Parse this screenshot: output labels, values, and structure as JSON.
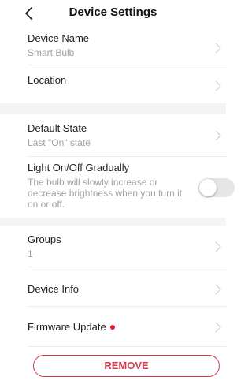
{
  "header": {
    "title": "Device Settings",
    "back_icon": "chevron-left-icon"
  },
  "device_name": {
    "label": "Device Name",
    "value": "Smart Bulb"
  },
  "location": {
    "label": "Location"
  },
  "default_state": {
    "label": "Default State",
    "value": "Last \"On\" state"
  },
  "gradual": {
    "label": "Light On/Off Gradually",
    "description": "The bulb will slowly increase or decrease brightness when you turn it on or off.",
    "enabled": false
  },
  "groups": {
    "label": "Groups",
    "value": "1"
  },
  "device_info": {
    "label": "Device Info"
  },
  "firmware": {
    "label": "Firmware Update",
    "has_update_indicator": true,
    "indicator_color": "#e0212d"
  },
  "remove_button": {
    "label": "REMOVE",
    "color": "#d33a4f"
  },
  "icons": {
    "row_arrow": "chevron-right-icon"
  }
}
